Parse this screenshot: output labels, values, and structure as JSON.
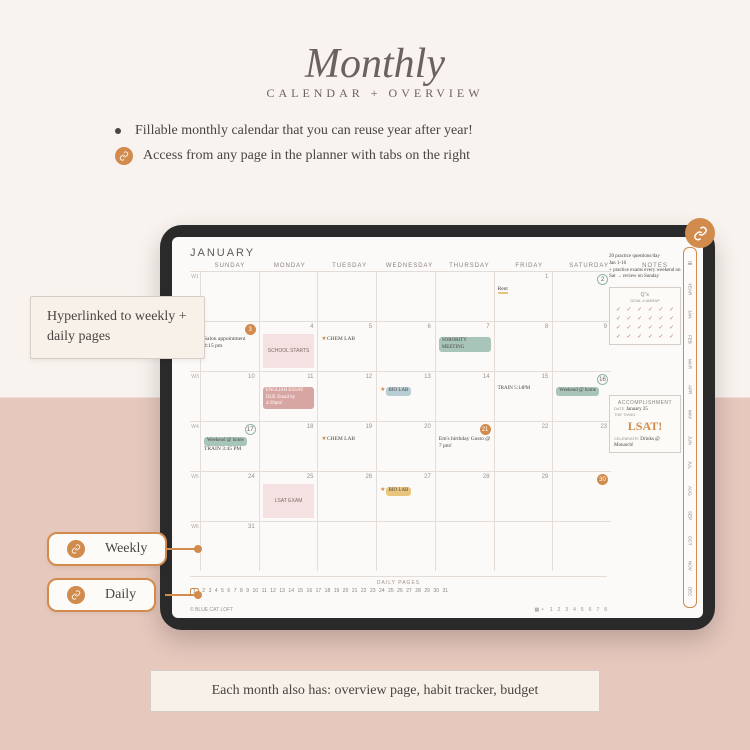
{
  "title": {
    "script": "Monthly",
    "subtitle": "CALENDAR + OVERVIEW"
  },
  "bullets": {
    "b1": "Fillable monthly calendar that you can reuse year after year!",
    "b2": "Access from any page in the planner with tabs on the right"
  },
  "callouts": {
    "hyper": "Hyperlinked to weekly + daily pages",
    "weekly": "Weekly",
    "daily": "Daily",
    "bottom": "Each month also has: overview page, habit tracker, budget"
  },
  "planner": {
    "month": "JANUARY",
    "daysOfWeek": [
      "SUNDAY",
      "MONDAY",
      "TUESDAY",
      "WEDNESDAY",
      "THURSDAY",
      "FRIDAY",
      "SATURDAY"
    ],
    "notesHeader": "NOTES",
    "weekLabels": [
      "W1",
      "W2",
      "W3",
      "W4",
      "W5",
      "W6"
    ],
    "notesText": "20 practice questions/day\nJan 1-16\n+ practice exams every weekend on Sat → review on Sunday",
    "goalsCard": {
      "title": "Q's",
      "sub": "GOAL #  AMRAP"
    },
    "accCard": {
      "title": "ACCOMPLISHMENT",
      "dateLabel": "DATE",
      "date": "January 25",
      "thingLabel": "THE THING",
      "thing": "LSAT!",
      "celLabel": "CELEBRATE!",
      "cel": "Drinks @ Monarch!"
    },
    "dailyPagesLabel": "DAILY PAGES",
    "footer": {
      "brand": "© BLUE CAT LOFT",
      "pages": [
        "1",
        "2",
        "3",
        "4",
        "5",
        "6",
        "7",
        "8"
      ]
    },
    "tabs": [
      "≡",
      "YEAR",
      "JAN",
      "FEB",
      "MAR",
      "APR",
      "MAY",
      "JUN",
      "JUL",
      "AUG",
      "SEP",
      "OCT",
      "NOV",
      "DEC"
    ],
    "entries": {
      "rent": "Rent",
      "salon": "Salon appointment 4:15 pm",
      "school": "SCHOOL STARTS",
      "chemlab": "CHEM LAB",
      "sorority": "SORORITY MEETING",
      "weekendHome": "Weekend @ home",
      "englishEssay": "ENGLISH ESSAY DUE Email by 4:30pm!",
      "biolab": "BIO LAB",
      "train": "TRAIN 5:14PM",
      "weekendHome2": "Weekend @ home",
      "train2": "TRAIN 3:45 PM",
      "chemlab2": "CHEM LAB",
      "emsbday": "Em's birthday Gusto @ 7 pm!",
      "lsatExam": "LSAT EXAM",
      "biolab2": "BIO LAB"
    },
    "dailyNums": [
      "1",
      "2",
      "3",
      "4",
      "5",
      "6",
      "7",
      "8",
      "9",
      "10",
      "11",
      "12",
      "13",
      "14",
      "15",
      "16",
      "17",
      "18",
      "19",
      "20",
      "21",
      "22",
      "23",
      "24",
      "25",
      "26",
      "27",
      "28",
      "29",
      "30",
      "31"
    ]
  }
}
